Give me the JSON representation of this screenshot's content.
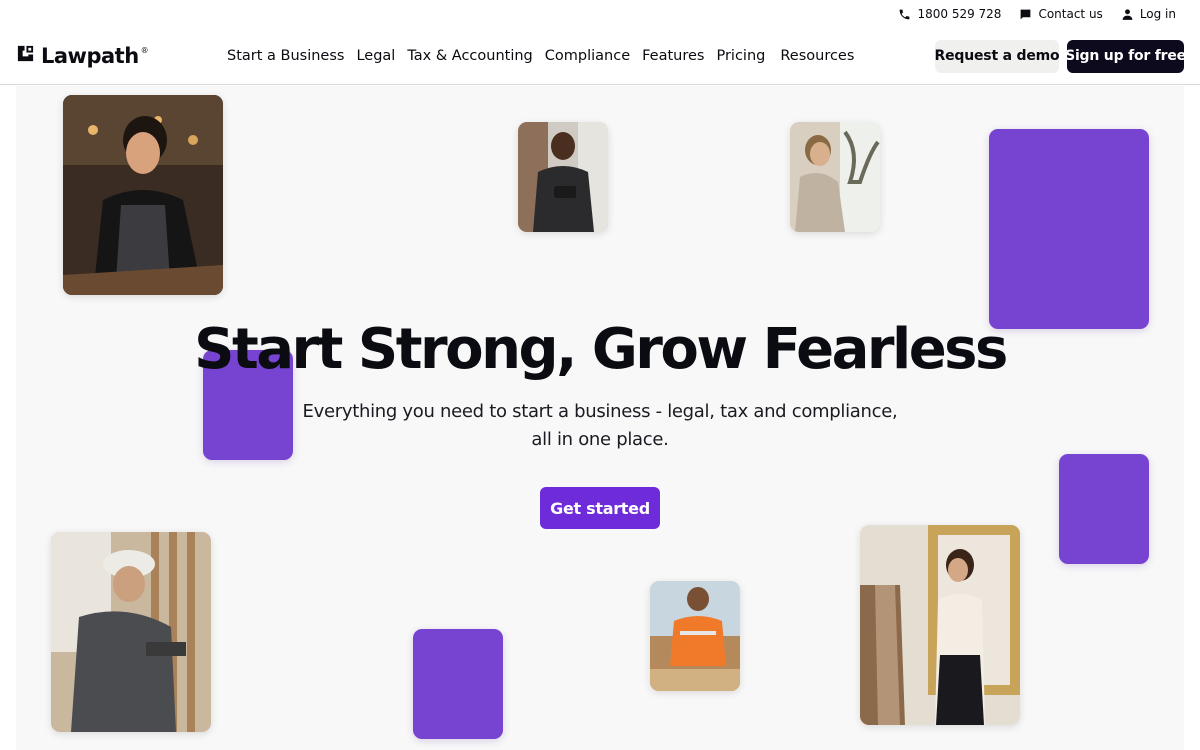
{
  "utility_bar": {
    "phone": "1800 529 728",
    "contact": "Contact us",
    "login": "Log in"
  },
  "header": {
    "logo_text": "Lawpath",
    "logo_mark": "®",
    "nav": [
      {
        "label": "Start a Business"
      },
      {
        "label": "Legal"
      },
      {
        "label": "Tax & Accounting"
      },
      {
        "label": "Compliance"
      },
      {
        "label": "Features"
      },
      {
        "label": "Pricing"
      },
      {
        "label": "Resources"
      }
    ],
    "request_demo": "Request a demo",
    "sign_up": "Sign up for free"
  },
  "hero": {
    "title": "Start Strong, Grow Fearless",
    "subtitle": "Everything you need to start a business - legal, tax and compliance, all in one place.",
    "cta": "Get started"
  },
  "colors": {
    "brand_purple": "#7744d1",
    "cta_purple": "#6d2bd9",
    "dark": "#0c0a1c",
    "hero_bg": "#f8f8f8"
  },
  "icons": [
    "phone-icon",
    "chat-icon",
    "user-icon",
    "lawpath-logo-icon"
  ]
}
